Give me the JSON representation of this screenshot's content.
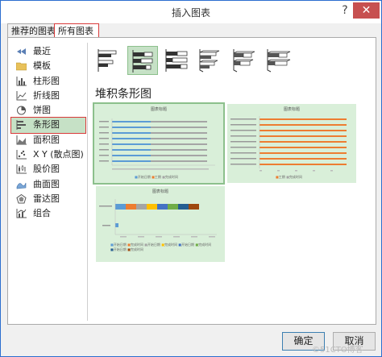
{
  "window": {
    "title": "插入图表",
    "help": "?",
    "close": "✕"
  },
  "tabs": [
    {
      "label": "推荐的图表"
    },
    {
      "label": "所有图表"
    }
  ],
  "categories": [
    {
      "label": "最近",
      "icon": "recent-icon"
    },
    {
      "label": "模板",
      "icon": "folder-icon"
    },
    {
      "label": "柱形图",
      "icon": "column-chart-icon"
    },
    {
      "label": "折线图",
      "icon": "line-chart-icon"
    },
    {
      "label": "饼图",
      "icon": "pie-chart-icon"
    },
    {
      "label": "条形图",
      "icon": "bar-chart-icon",
      "selected": true
    },
    {
      "label": "面积图",
      "icon": "area-chart-icon"
    },
    {
      "label": "X Y (散点图)",
      "icon": "scatter-chart-icon"
    },
    {
      "label": "股价图",
      "icon": "stock-chart-icon"
    },
    {
      "label": "曲面图",
      "icon": "surface-chart-icon"
    },
    {
      "label": "雷达图",
      "icon": "radar-chart-icon"
    },
    {
      "label": "组合",
      "icon": "combo-chart-icon"
    }
  ],
  "subtypes": [
    {
      "name": "clustered-bar",
      "selected": false
    },
    {
      "name": "stacked-bar",
      "selected": true
    },
    {
      "name": "100-stacked-bar",
      "selected": false
    },
    {
      "name": "3d-clustered-bar",
      "selected": false
    },
    {
      "name": "3d-stacked-bar",
      "selected": false
    },
    {
      "name": "3d-100-stacked-bar",
      "selected": false
    }
  ],
  "section_title": "堆积条形图",
  "previews": [
    {
      "title": "图表标题",
      "bar_colors": [
        "#5b9bd5",
        "#a5a5a5"
      ],
      "legend": [
        "开始日期",
        "工期",
        "完成时间"
      ]
    },
    {
      "title": "图表标题",
      "bar_colors": [
        "#ed7d31"
      ],
      "legend": [
        "工期",
        "完成时间"
      ]
    },
    {
      "title": "图表标题",
      "legend": [
        "开始日期",
        "完成时间",
        "开始日期",
        "完成时间",
        "开始日期",
        "完成时间",
        "开始日期",
        "完成时间"
      ]
    }
  ],
  "buttons": {
    "ok": "确定",
    "cancel": "取消"
  },
  "watermark": "©51CTO博客"
}
